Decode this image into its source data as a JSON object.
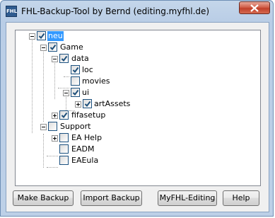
{
  "window": {
    "title": "FHL-Backup-Tool by Bernd (editing.myfhl.de)",
    "icon_text": "FHL"
  },
  "tree": {
    "nodes": [
      {
        "label": "neu",
        "checked": true,
        "expanded": true,
        "selected": true
      },
      {
        "label": "Game",
        "checked": true,
        "expanded": true
      },
      {
        "label": "data",
        "checked": true,
        "expanded": true
      },
      {
        "label": "loc",
        "checked": true
      },
      {
        "label": "movies",
        "checked": false
      },
      {
        "label": "ui",
        "checked": true,
        "expanded": true
      },
      {
        "label": "artAssets",
        "checked": true,
        "expanded": false
      },
      {
        "label": "fifasetup",
        "checked": true,
        "expanded": false
      },
      {
        "label": "Support",
        "checked": false,
        "expanded": true
      },
      {
        "label": "EA Help",
        "checked": false,
        "expanded": false
      },
      {
        "label": "EADM",
        "checked": false
      },
      {
        "label": "EAEula",
        "checked": false
      }
    ]
  },
  "buttons": {
    "make_backup": "Make Backup",
    "import_backup": "Import Backup",
    "myfhl_editing": "MyFHL-Editing",
    "help": "Help"
  },
  "colors": {
    "selection": "#3399ff",
    "close_button": "#c1402a",
    "frame": "#bdd0e7"
  }
}
